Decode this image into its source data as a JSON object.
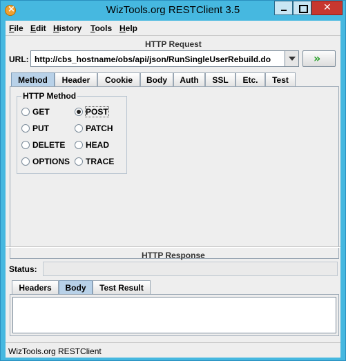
{
  "window": {
    "title": "WizTools.org RESTClient 3.5"
  },
  "menu": [
    {
      "first": "F",
      "rest": "ile"
    },
    {
      "first": "E",
      "rest": "dit"
    },
    {
      "first": "H",
      "rest": "istory"
    },
    {
      "first": "T",
      "rest": "ools"
    },
    {
      "first": "H",
      "rest": "elp"
    }
  ],
  "request": {
    "section_title": "HTTP Request",
    "url_label": "URL:",
    "url_value": "http://cbs_hostname/obs/api/json/RunSingleUserRebuild.do",
    "go_glyph": "»",
    "tabs": [
      "Method",
      "Header",
      "Cookie",
      "Body",
      "Auth",
      "SSL",
      "Etc.",
      "Test"
    ],
    "selected_tab": "Method",
    "method_group_title": "HTTP Method",
    "methods": [
      {
        "label": "GET",
        "selected": false
      },
      {
        "label": "POST",
        "selected": true
      },
      {
        "label": "PUT",
        "selected": false
      },
      {
        "label": "PATCH",
        "selected": false
      },
      {
        "label": "DELETE",
        "selected": false
      },
      {
        "label": "HEAD",
        "selected": false
      },
      {
        "label": "OPTIONS",
        "selected": false
      },
      {
        "label": "TRACE",
        "selected": false
      }
    ]
  },
  "response": {
    "section_title": "HTTP Response",
    "status_label": "Status:",
    "status_value": "",
    "tabs": [
      "Headers",
      "Body",
      "Test Result"
    ],
    "selected_tab": "Body",
    "body_text": ""
  },
  "statusbar": {
    "text": "WizTools.org RESTClient"
  }
}
